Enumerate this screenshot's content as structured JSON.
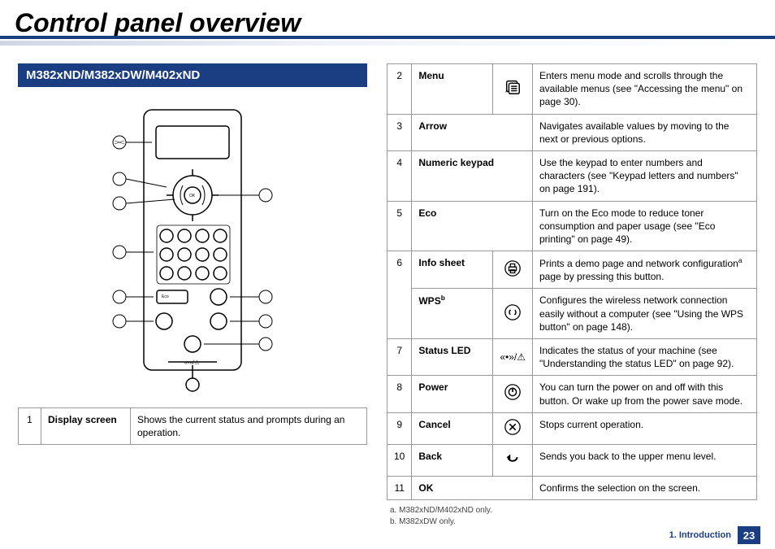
{
  "title": "Control panel overview",
  "model_band": "M382xND/M382xDW/M402xND",
  "left_table": {
    "num": "1",
    "name": "Display screen",
    "desc": "Shows the current status and prompts during an operation."
  },
  "rows": [
    {
      "num": "2",
      "name": "Menu",
      "icon": "menu",
      "desc": "Enters menu mode and scrolls through the available menus (see \"Accessing the menu\" on page 30)."
    },
    {
      "num": "3",
      "name": "Arrow",
      "icon": "",
      "desc": "Navigates available values by moving to the next or previous options."
    },
    {
      "num": "4",
      "name": "Numeric keypad",
      "icon": "",
      "desc": "Use the keypad to enter numbers and characters (see \"Keypad letters and numbers\" on page 191)."
    },
    {
      "num": "5",
      "name": "Eco",
      "icon": "",
      "desc": "Turn on the Eco mode to reduce toner consumption and paper usage (see \"Eco printing\" on page 49)."
    },
    {
      "num": "6a",
      "name": "Info sheet",
      "icon": "print",
      "desc": "Prints a demo page and network configurationa page by pressing this button.",
      "name_sup": ""
    },
    {
      "num": "6b",
      "name": "WPS",
      "icon": "wps",
      "desc": "Configures the wireless network connection easily without a computer (see \"Using the WPS button\" on page 148).",
      "name_sup": "b"
    },
    {
      "num": "7",
      "name": "Status LED",
      "icon": "status",
      "desc": "Indicates the status of your machine (see \"Understanding the status LED\" on page 92)."
    },
    {
      "num": "8",
      "name": "Power",
      "icon": "power",
      "desc": "You can turn the power on and off with this button. Or wake up from the power save mode."
    },
    {
      "num": "9",
      "name": "Cancel",
      "icon": "cancel",
      "desc": "Stops current operation."
    },
    {
      "num": "10",
      "name": "Back",
      "icon": "back",
      "desc": "Sends you back to the upper menu level."
    },
    {
      "num": "11",
      "name": "OK",
      "icon": "",
      "desc": "Confirms the selection on the screen."
    }
  ],
  "row6_num": "6",
  "footnotes": {
    "a": "a.  M382xND/M402xND only.",
    "b": "b.  M382xDW only."
  },
  "footer": {
    "chapter": "1. Introduction",
    "page": "23"
  }
}
